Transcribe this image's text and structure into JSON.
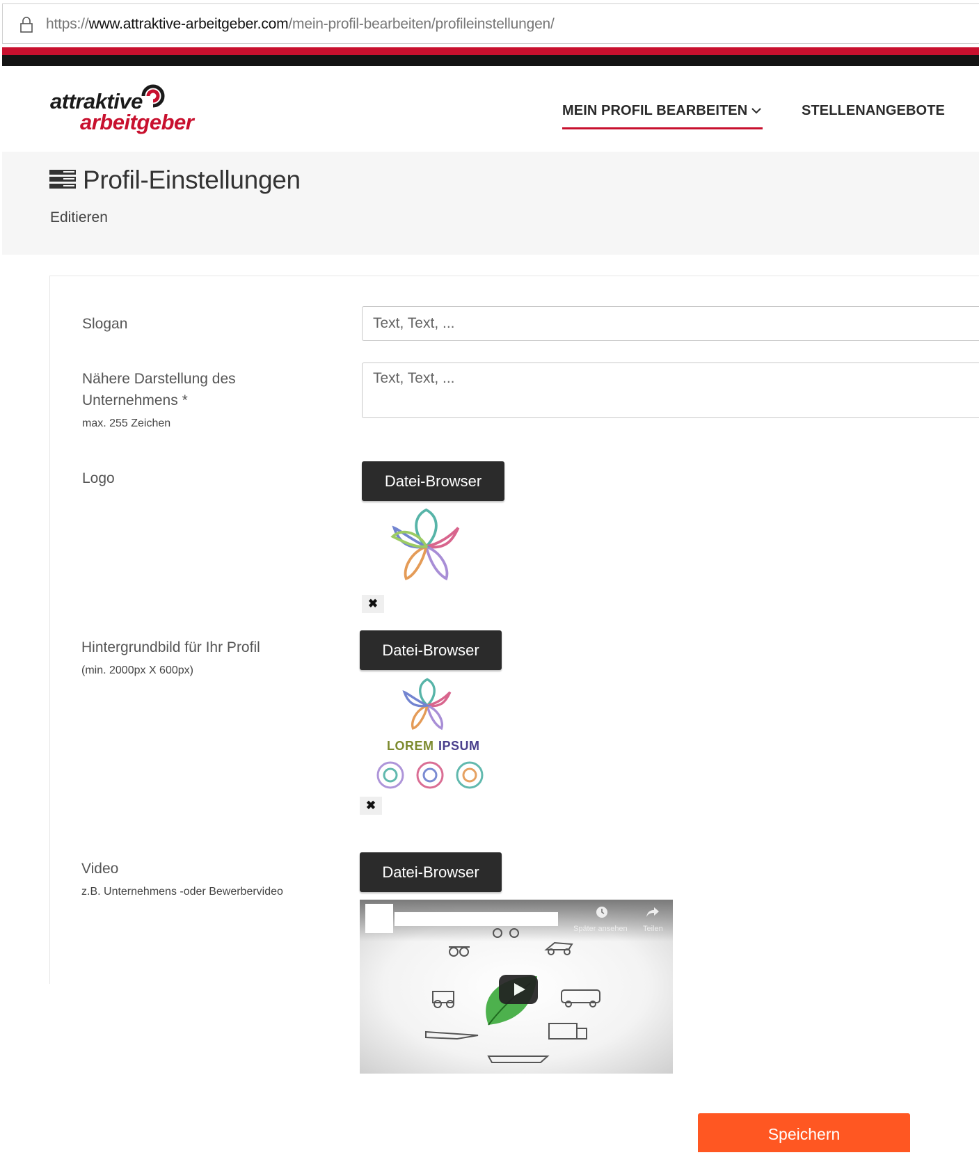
{
  "browser": {
    "url_scheme": "https://",
    "url_domain": "www.attraktive-arbeitgeber.com",
    "url_path": "/mein-profil-bearbeiten/profileinstellungen/"
  },
  "brand": {
    "logo_line1": "attraktive",
    "logo_line2": "arbeitgeber",
    "accent": "#c8102e"
  },
  "nav": {
    "profile_label": "MEIN PROFIL BEARBEITEN",
    "jobs_label": "STELLENANGEBOTE"
  },
  "page": {
    "title": "Profil-Einstellungen",
    "subtitle": "Editieren"
  },
  "form": {
    "slogan": {
      "label": "Slogan",
      "placeholder": "Text, Text, ..."
    },
    "description": {
      "label_line1": "Nähere Darstellung des",
      "label_line2": "Unternehmens *",
      "hint": "max. 255 Zeichen",
      "placeholder": "Text, Text, ..."
    },
    "logo": {
      "label": "Logo",
      "button": "Datei-Browser",
      "remove": "✖"
    },
    "background": {
      "label": "Hintergrundbild für Ihr Profil",
      "hint": "(min. 2000px X 600px)",
      "button": "Datei-Browser",
      "remove": "✖",
      "preview_word1": "LOREM",
      "preview_word2": "IPSUM"
    },
    "video": {
      "label": "Video",
      "hint": "z.B. Unternehmens -oder Bewerbervideo",
      "button": "Datei-Browser",
      "watch_later": "Später ansehen",
      "share": "Teilen"
    },
    "save_label": "Speichern"
  },
  "colors": {
    "save_button": "#ff5722",
    "dark_button": "#2b2b2b"
  }
}
